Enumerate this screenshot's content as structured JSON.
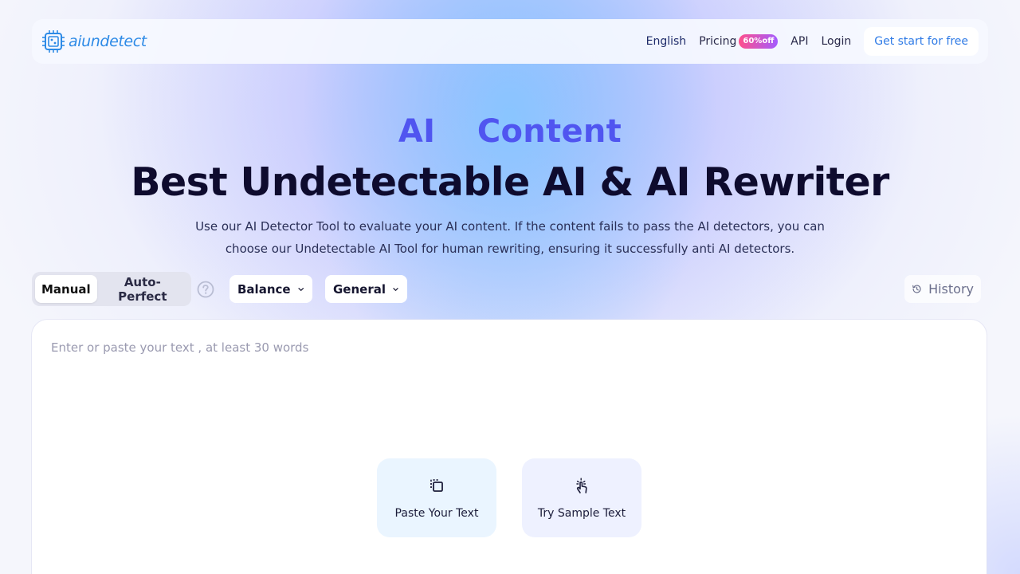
{
  "header": {
    "logo_text": "aiundetect",
    "nav": {
      "language": "English",
      "pricing": "Pricing",
      "pricing_badge": "60%off",
      "api": "API",
      "login": "Login",
      "cta": "Get start for free"
    }
  },
  "hero": {
    "subtitle": "AI  Content",
    "title": "Best Undetectable AI & AI Rewriter",
    "description": "Use our AI Detector Tool to evaluate your AI content. If the content fails to pass the AI detectors, you can choose our Undetectable AI Tool for human rewriting, ensuring it successfully anti AI detectors."
  },
  "controls": {
    "modes": [
      "Manual",
      "Auto-Perfect"
    ],
    "active_mode": "Manual",
    "strength_select": "Balance",
    "purpose_select": "General",
    "history_label": "History"
  },
  "editor": {
    "placeholder": "Enter or paste your text , at least 30 words",
    "paste_label": "Paste Your Text",
    "sample_label": "Try Sample Text"
  },
  "colors": {
    "accent": "#5055f0",
    "brand_blue": "#2d8ae6",
    "title": "#0e0b2e"
  },
  "icons": {
    "logo": "chip-logo-icon",
    "help": "question-circle-icon",
    "chevron": "chevron-down-icon",
    "history": "history-clock-icon",
    "paste": "paste-clipboard-icon",
    "sample": "tap-hand-icon"
  }
}
